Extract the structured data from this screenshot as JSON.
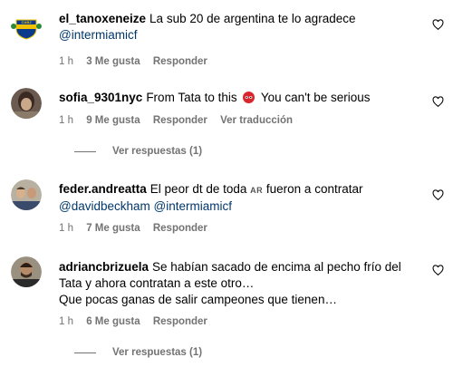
{
  "comments": [
    {
      "username": "el_tanoxeneize",
      "text": "La sub 20 de argentina te lo agradece",
      "mentions": "@intermiamicf",
      "time": "1 h",
      "likes": "3 Me gusta",
      "reply": "Responder"
    },
    {
      "username": "sofia_9301nyc",
      "text_before": "From Tata to this",
      "text_after": "You can't be serious",
      "time": "1 h",
      "likes": "9 Me gusta",
      "reply": "Responder",
      "translate": "Ver traducción",
      "view_replies": "Ver respuestas (1)"
    },
    {
      "username": "feder.andreatta",
      "text_before": "El peor dt de toda",
      "country_code": "AR",
      "text_after": "fueron a contratar",
      "mentions": "@davidbeckham @intermiamicf",
      "time": "1 h",
      "likes": "7 Me gusta",
      "reply": "Responder"
    },
    {
      "username": "adriancbrizuela",
      "text_line1": "Se habían sacado de encima al pecho frío del Tata y ahora contratan a este otro…",
      "text_line2": "Que pocas ganas de salir campeones que tienen…",
      "time": "1 h",
      "likes": "6 Me gusta",
      "reply": "Responder",
      "view_replies": "Ver respuestas (1)"
    }
  ],
  "icons": {
    "like": "heart-outline-icon",
    "emoji": "angry-face-emoji"
  },
  "colors": {
    "mention": "#00376b",
    "meta": "#737373",
    "text": "#000000",
    "boca_blue": "#0a3a8c",
    "boca_yellow": "#f2c200",
    "emoji_red": "#d9262c"
  }
}
